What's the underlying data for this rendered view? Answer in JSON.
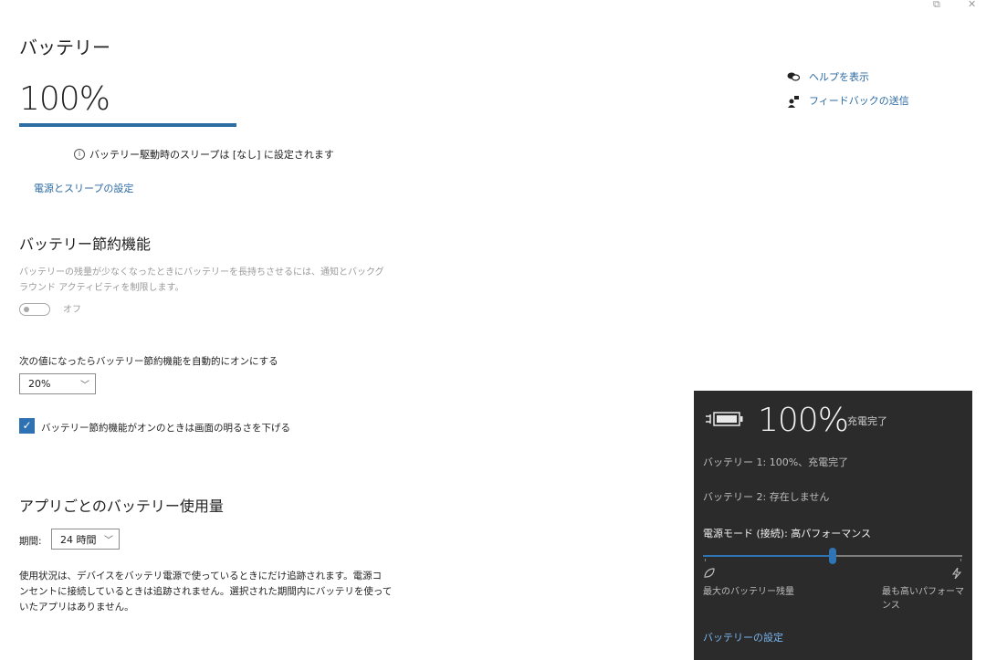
{
  "window_controls": {
    "restore_glyph": "⧉",
    "close_glyph": "✕"
  },
  "page": {
    "title": "バッテリー",
    "battery_percent_text": "100%",
    "battery_level": 1.0,
    "sleep_note": "バッテリー駆動時のスリープは [なし] に設定されます",
    "power_sleep_link": "電源とスリープの設定"
  },
  "help": {
    "show_help": "ヘルプを表示",
    "send_feedback": "フィードバックの送信"
  },
  "saver": {
    "heading": "バッテリー節約機能",
    "description_line1": "バッテリーの残量が少なくなったときにバッテリーを長持ちさせるには、通知とバックグ",
    "description_line2": "ラウンド アクティビティを制限します。",
    "toggle_state": "オフ",
    "auto_on_label": "次の値になったらバッテリー節約機能を自動的にオンにする",
    "auto_on_value": "20%",
    "lower_brightness_label": "バッテリー節約機能がオンのときは画面の明るさを下げる",
    "lower_brightness_checked": true
  },
  "usage": {
    "heading": "アプリごとのバッテリー使用量",
    "period_label": "期間:",
    "period_value": "24 時間",
    "desc_line1": "使用状況は、デバイスをバッテリ電源で使っているときにだけ追跡されます。電源コ",
    "desc_line2": "ンセントに接続しているときは追跡されません。選択された期間内にバッテリを使って",
    "desc_line3": "いたアプリはありません。"
  },
  "flyout": {
    "percent_text": "100%",
    "status": "充電完了",
    "battery1": "バッテリー 1: 100%、充電完了",
    "battery2": "バッテリー 2: 存在しません",
    "power_mode": "電源モード (接続): 高パフォーマンス",
    "slider_level": 0.5,
    "left_label": "最大のバッテリー残量",
    "right_label": "最も高いパフォーマンス",
    "settings_link": "バッテリーの設定",
    "left_icon": "leaf-icon",
    "right_icon": "bolt-icon"
  },
  "colors": {
    "accent": "#2c6da3",
    "flyout_bg": "#2b2b2b",
    "link": "#2b6aa3"
  }
}
